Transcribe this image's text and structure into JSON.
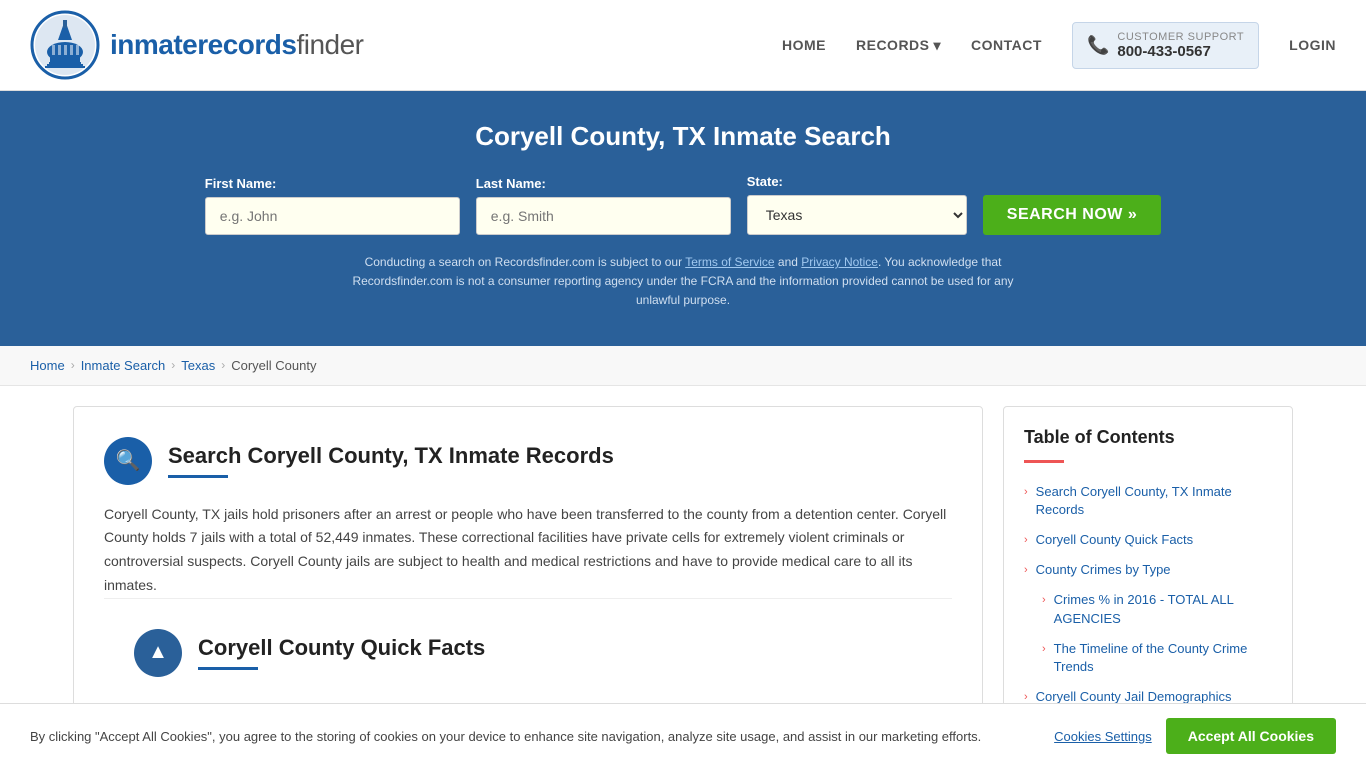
{
  "header": {
    "logo_text_plain": "inmaterecords",
    "logo_text_bold": "finder",
    "nav": {
      "home": "HOME",
      "records": "RECORDS",
      "contact": "CONTACT",
      "support_label": "CUSTOMER SUPPORT",
      "support_number": "800-433-0567",
      "login": "LOGIN"
    }
  },
  "hero": {
    "title": "Coryell County, TX Inmate Search",
    "first_name_label": "First Name:",
    "first_name_placeholder": "e.g. John",
    "last_name_label": "Last Name:",
    "last_name_placeholder": "e.g. Smith",
    "state_label": "State:",
    "state_value": "Texas",
    "search_btn": "SEARCH NOW »",
    "disclaimer": "Conducting a search on Recordsfinder.com is subject to our Terms of Service and Privacy Notice. You acknowledge that Recordsfinder.com is not a consumer reporting agency under the FCRA and the information provided cannot be used for any unlawful purpose.",
    "tos_link": "Terms of Service",
    "privacy_link": "Privacy Notice"
  },
  "breadcrumb": {
    "items": [
      "Home",
      "Inmate Search",
      "Texas",
      "Coryell County"
    ]
  },
  "main_section": {
    "title": "Search Coryell County, TX Inmate Records",
    "body": "Coryell County, TX jails hold prisoners after an arrest or people who have been transferred to the county from a detention center. Coryell County holds 7 jails with a total of 52,449 inmates. These correctional facilities have private cells for extremely violent criminals or controversial suspects. Coryell County jails are subject to health and medical restrictions and have to provide medical care to all its inmates."
  },
  "quick_facts_section": {
    "title": "Coryell County Quick Facts"
  },
  "table_of_contents": {
    "title": "Table of Contents",
    "items": [
      {
        "label": "Search Coryell County, TX Inmate Records",
        "sub": false
      },
      {
        "label": "Coryell County Quick Facts",
        "sub": false
      },
      {
        "label": "County Crimes by Type",
        "sub": false
      },
      {
        "label": "Crimes % in 2016 - TOTAL ALL AGENCIES",
        "sub": true
      },
      {
        "label": "The Timeline of the County Crime Trends",
        "sub": true
      },
      {
        "label": "Coryell County Jail Demographics",
        "sub": false
      }
    ]
  },
  "cookie_banner": {
    "text": "By clicking \"Accept All Cookies\", you agree to the storing of cookies on your device to enhance site navigation, analyze site usage, and assist in our marketing efforts.",
    "settings_btn": "Cookies Settings",
    "accept_btn": "Accept All Cookies"
  }
}
